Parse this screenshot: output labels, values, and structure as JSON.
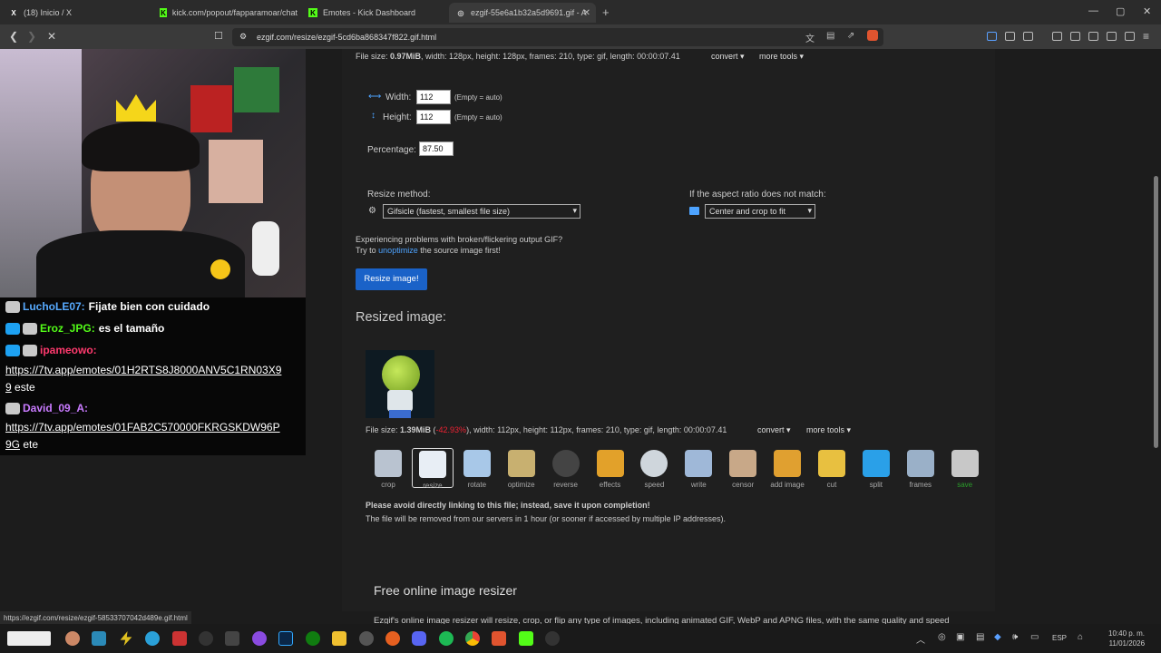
{
  "tabs": [
    {
      "label": "(18) Inicio / X",
      "icon": "X"
    },
    {
      "label": "kick.com/popout/fapparamoar/chat",
      "icon": "K"
    },
    {
      "label": "Emotes - Kick Dashboard",
      "icon": "K"
    },
    {
      "label": "ezgif-55e6a1b32a5d9691.gif - A",
      "icon": "◎"
    }
  ],
  "address": "ezgif.com/resize/ezgif-5cd6ba868347f822.gif.html",
  "chat": [
    {
      "user": "LuchoLE07:",
      "msg": "Fijate bien con cuidado",
      "color": "#57aaff"
    },
    {
      "user": "Eroz_JPG:",
      "msg": "es el tamaño",
      "color": "#53fc18"
    },
    {
      "user": "ipameowo:",
      "msg": "",
      "color": "#ff3a6e"
    },
    {
      "link": "https://7tv.app/emotes/01H2RTS8J8000ANV5C1RN03X9",
      "link2": "9",
      "tail": "este"
    },
    {
      "user": "David_09_A:",
      "msg": "",
      "color": "#c97bff"
    },
    {
      "link": "https://7tv.app/emotes/01FAB2C570000FKRGSKDW96P",
      "link2": "9G",
      "tail": "ete"
    }
  ],
  "page": {
    "filesize_label": "File size: ",
    "filesize_val": "0.97MiB",
    "filesize_rest": ", width: 128px, height: 128px, frames: 210, type: gif, length: 00:00:07.41",
    "convert": "convert",
    "moretools": "more tools",
    "width_label": "Width:",
    "width_val": "112",
    "height_label": "Height:",
    "height_val": "112",
    "empty_auto": "(Empty = auto)",
    "percentage_label": "Percentage:",
    "percentage_val": "87.50",
    "method_label": "Resize method:",
    "method_val": "Gifsicle (fastest, smallest file size)",
    "aspect_label": "If the aspect ratio does not match:",
    "aspect_val": "Center and crop to fit",
    "problem1": "Experiencing problems with broken/flickering output GIF?",
    "problem2a": "Try to ",
    "problem2link": "unoptimize",
    "problem2b": " the source image first!",
    "resize_btn": "Resize image!",
    "resized_title": "Resized image:",
    "out_filesize_label": "File size: ",
    "out_filesize_val": "1.39MiB",
    "out_pct": "-42.93%",
    "out_rest": ", width: 112px, height: 112px, frames: 210, type: gif, length: 00:00:07.41",
    "warn1": "Please avoid directly linking to this file; instead, save it upon completion!",
    "warn2": "The file will be removed from our servers in 1 hour (or sooner if accessed by multiple IP addresses).",
    "free_title": "Free online image resizer",
    "free_text": "Ezgif's online image resizer will resize, crop, or flip any type of images, including animated GIF, WebP and APNG files, with the same quality and speed"
  },
  "tools": [
    "crop",
    "resize",
    "rotate",
    "optimize",
    "reverse",
    "effects",
    "speed",
    "write",
    "censor",
    "add image",
    "cut",
    "split",
    "frames",
    "save"
  ],
  "status_url": "https://ezgif.com/resize/ezgif-58533707042d489e.gif.html",
  "clock": {
    "time": "10:40 p. m.",
    "date": "11/01/2026",
    "lang": "ESP"
  }
}
